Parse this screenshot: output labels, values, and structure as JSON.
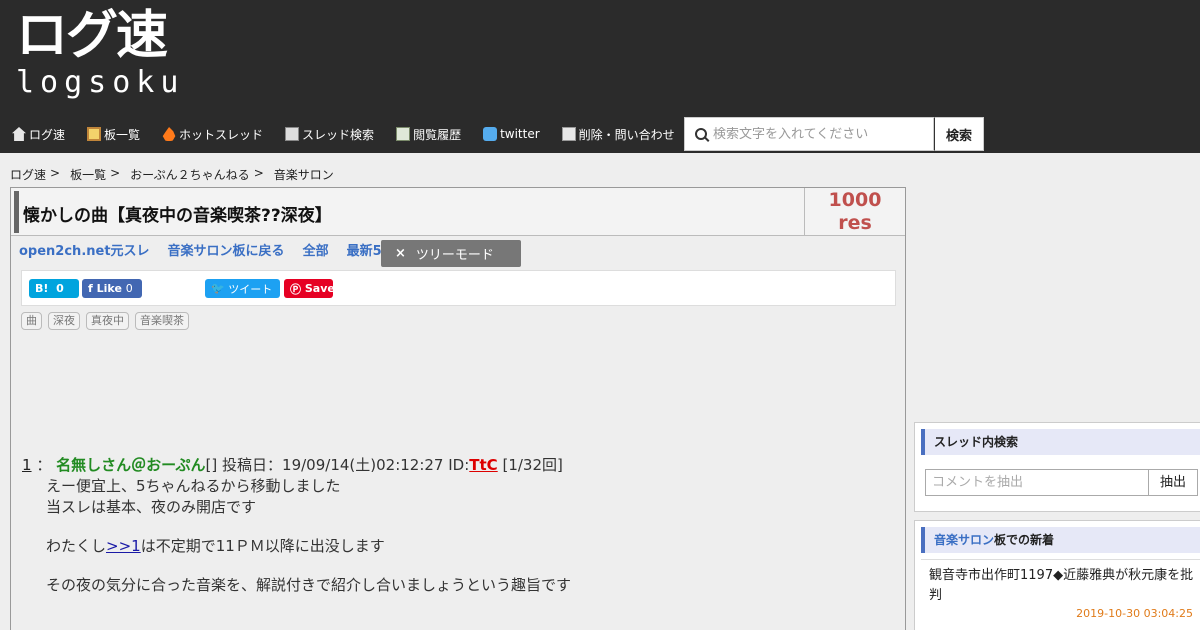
{
  "site": {
    "logo_jp": "ログ速",
    "logo_en": "logsoku"
  },
  "nav": {
    "items": [
      {
        "label": "ログ速",
        "icon": "home-icon"
      },
      {
        "label": "板一覧",
        "icon": "board-icon"
      },
      {
        "label": "ホットスレッド",
        "icon": "fire-icon"
      },
      {
        "label": "スレッド検索",
        "icon": "search-doc-icon"
      },
      {
        "label": "閲覧履歴",
        "icon": "history-icon"
      },
      {
        "label": "twitter",
        "icon": "twitter-icon"
      },
      {
        "label": "削除・問い合わせ",
        "icon": "mail-icon"
      }
    ]
  },
  "search": {
    "placeholder": "検索文字を入れてください",
    "button": "検索"
  },
  "breadcrumb": [
    "ログ速",
    "板一覧",
    "おーぷん２ちゃんねる",
    "音楽サロン"
  ],
  "breadcrumb_sep": ">",
  "thread": {
    "title": "懐かしの曲【真夜中の音楽喫茶??深夜】",
    "res_count": "1000",
    "res_label": "res",
    "links": [
      "open2ch.net元スレ",
      "音楽サロン板に戻る",
      "全部",
      "最新50"
    ],
    "tree_mode": "ツリーモード",
    "tree_close": "×",
    "tags": [
      "曲",
      "深夜",
      "真夜中",
      "音楽喫茶"
    ]
  },
  "share": {
    "hatena": "B!",
    "hatena_count": "0",
    "fb_like": "Like",
    "fb_count": "0",
    "tweet": "ツイート",
    "pin": "Save"
  },
  "post": {
    "number": "1",
    "colon": "：",
    "name": "名無しさん＠おーぷん",
    "bracket": "[]",
    "posted_label": "投稿日：19/09/14(土)02:12:27 ID:",
    "id": "TtC",
    "count": "[1/32回]",
    "line1": "えー便宜上、5ちゃんねるから移動しました",
    "line2": "当スレは基本、夜のみ開店です",
    "line3_pre": "わたくし",
    "line3_anchor": ">>1",
    "line3_post": "は不定期で11ＰＭ以降に出没します",
    "line4": "その夜の気分に合った音楽を、解説付きで紹介し合いましょうという趣旨です"
  },
  "sidebar": {
    "search_title": "スレッド内検索",
    "search_placeholder": "コメントを抽出",
    "search_button": "抽出",
    "new_board": "音楽サロン",
    "new_title_suffix": "板での新着",
    "new_item": "観音寺市出作町1197◆近藤雅典が秋元康を批判",
    "new_date": "2019-10-30 03:04:25"
  },
  "colors": {
    "header_bg": "#2b2b2b",
    "res_red": "#c0504d",
    "link_blue": "#3a6fc4",
    "name_green": "#228b22",
    "id_red": "#dd0000"
  }
}
